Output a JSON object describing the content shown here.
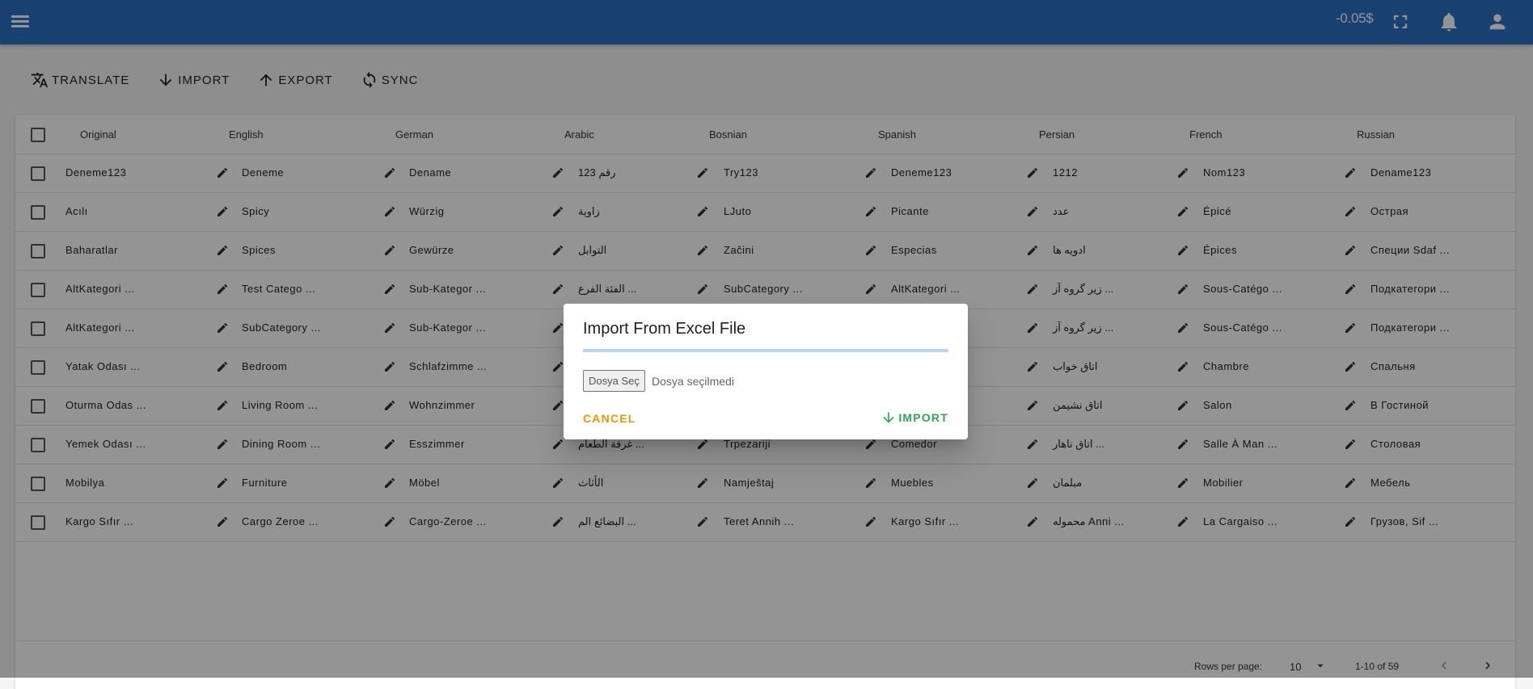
{
  "appbar": {
    "balance": "-0.05$",
    "icons": [
      "menu-icon",
      "fullscreen-icon",
      "bell-icon",
      "account-icon"
    ],
    "color": "#2a6fc2"
  },
  "toolbar": {
    "translate": "TRANSLATE",
    "import": "IMPORT",
    "export": "EXPORT",
    "sync": "SYNC"
  },
  "table": {
    "columns": [
      "Original",
      "English",
      "German",
      "Arabic",
      "Bosnian",
      "Spanish",
      "Persian",
      "French",
      "Russian"
    ],
    "rows": [
      [
        "Deneme123",
        "Deneme",
        "Dename",
        "رقم 123",
        "Try123",
        "Deneme123",
        "1212",
        "Nom123",
        "Dename123"
      ],
      [
        "Acılı",
        "Spicy",
        "Würzig",
        "زاوية",
        "LJuto",
        "Picante",
        "عدد",
        "Épicé",
        "Острая"
      ],
      [
        "Baharatlar",
        "Spices",
        "Gewürze",
        "التوابل",
        "Začini",
        "Especias",
        "ادویه ها",
        "Épices",
        "Специи Sdaf ..."
      ],
      [
        "AltKategori ...",
        "Test Catego ...",
        "Sub-Kategor ...",
        "الفئة الفرع ...",
        "SubCategory ...",
        "AltKategori ...",
        "زیر گروه آز ...",
        "Sous-Catégo ...",
        "Подкатегори ..."
      ],
      [
        "AltKategori ...",
        "SubCategory ...",
        "Sub-Kategor ...",
        "",
        "",
        "",
        "زیر گروه آز ...",
        "Sous-Catégo ...",
        "Подкатегори ..."
      ],
      [
        "Yatak Odası ...",
        "Bedroom",
        "Schlafzimme ...",
        "",
        "",
        "",
        "اتاق خواب",
        "Chambre",
        "Спальня"
      ],
      [
        "Oturma Odas ...",
        "Living Room ...",
        "Wohnzimmer",
        "",
        "",
        "",
        "اتاق نشیمن",
        "Salon",
        "В Гостиной"
      ],
      [
        "Yemek Odası ...",
        "Dining Room ...",
        "Esszimmer",
        "غرفة الطعام ...",
        "Trpezariji",
        "Comedor",
        "اتاق ناهار ...",
        "Salle À Man ...",
        "Столовая"
      ],
      [
        "Mobilya",
        "Furniture",
        "Möbel",
        "الأثاث",
        "Namještaj",
        "Muebles",
        "مبلمان",
        "Mobilier",
        "Мебель"
      ],
      [
        "Kargo Sıfır ...",
        "Cargo Zeroe ...",
        "Cargo-Zeroe ...",
        "البضائع الم ...",
        "Teret Annih ...",
        "Kargo Sıfır ...",
        "محموله Anni ...",
        "La Cargaiso ...",
        "Грузов, Sif ..."
      ]
    ]
  },
  "pagination": {
    "rows_per_page_label": "Rows per page:",
    "rows_per_page": "10",
    "range": "1-10 of 59"
  },
  "dialog": {
    "title": "Import From Excel File",
    "file_button": "Dosya Seç",
    "file_status": "Dosya seçilmedi",
    "cancel": "CANCEL",
    "import": "IMPORT",
    "cancel_color": "#f29400",
    "import_color": "#2ea84a"
  }
}
